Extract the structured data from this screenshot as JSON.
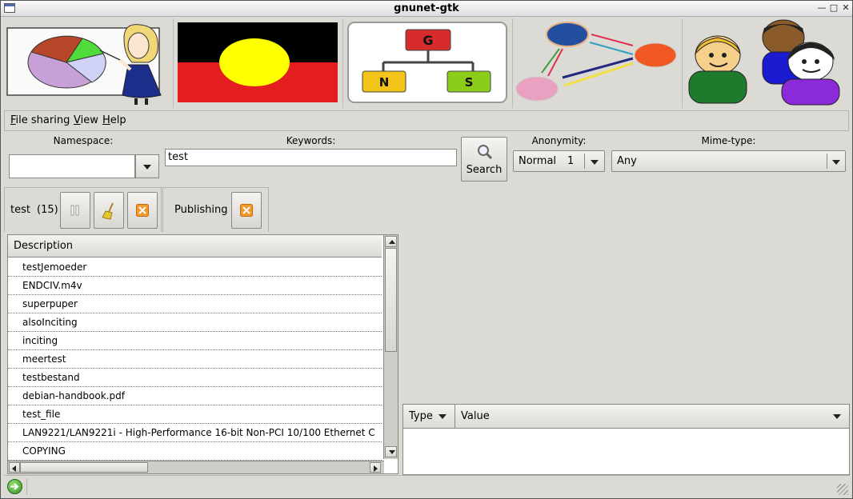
{
  "window": {
    "title": "gnunet-gtk"
  },
  "menu": [
    {
      "label": "File sharing",
      "mnemonic": "F",
      "rest": "ile sharing"
    },
    {
      "label": "View",
      "mnemonic": "V",
      "rest": "iew"
    },
    {
      "label": "Help",
      "mnemonic": "H",
      "rest": "elp"
    }
  ],
  "search": {
    "namespace_label": "Namespace:",
    "namespace_value": "",
    "keywords_label": "Keywords:",
    "keywords_value": "test",
    "search_button": "Search",
    "anonymity_label": "Anonymity:",
    "anonymity_level": "Normal",
    "anonymity_value": "1",
    "mime_label": "Mime-type:",
    "mime_value": "Any"
  },
  "tabs": {
    "search_tab": {
      "query": "test",
      "count": "(15)"
    },
    "publishing_tab": {
      "label": "Publishing"
    }
  },
  "results": {
    "column": "Description",
    "rows": [
      "testJemoeder",
      "ENDCIV.m4v",
      "superpuper",
      "alsoInciting",
      "inciting",
      "meertest",
      "testbestand",
      "debian-handbook.pdf",
      "test_file",
      "LAN9221/LAN9221i - High-Performance 16-bit Non-PCI 10/100 Ethernet C",
      "COPYING"
    ]
  },
  "metadata": {
    "type_col": "Type",
    "value_col": "Value"
  },
  "icons": {
    "status": "connected-arrow-icon",
    "pause": "pause-icon",
    "clear": "broom-icon",
    "close": "close-x-icon",
    "search": "magnifier-icon"
  }
}
